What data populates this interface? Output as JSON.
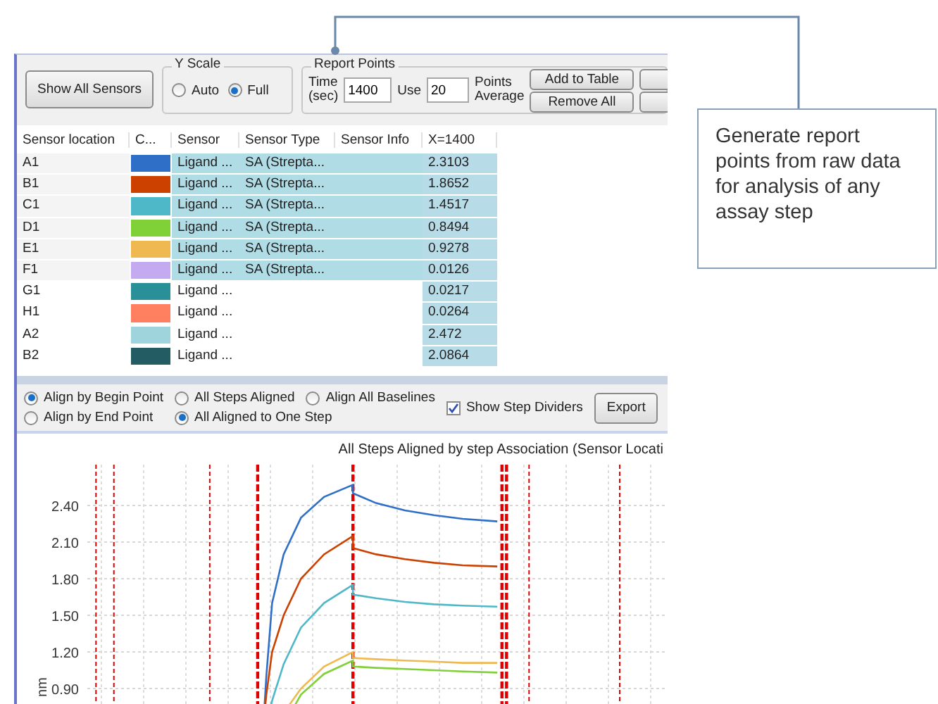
{
  "toolbar": {
    "show_all_button": "Show All Sensors",
    "y_scale": {
      "title": "Y Scale",
      "options": [
        {
          "label": "Auto",
          "selected": false
        },
        {
          "label": "Full",
          "selected": true
        }
      ]
    },
    "report_points": {
      "title": "Report Points",
      "time_label": "Time (sec)",
      "time_value": "1400",
      "use_label": "Use",
      "use_value": "20",
      "points_label": "Points Average",
      "buttons": [
        "Add to Table",
        "Remove All"
      ]
    }
  },
  "table": {
    "columns": [
      "Sensor location",
      "C...",
      "Sensor",
      "Sensor Type",
      "Sensor Info",
      "X=1400"
    ],
    "rows": [
      {
        "location": "A1",
        "color": "#2f6fc8",
        "sensor": "Ligand ...",
        "type": "SA (Strepta...",
        "value": "2.3103",
        "selected": true
      },
      {
        "location": "B1",
        "color": "#cc4000",
        "sensor": "Ligand ...",
        "type": "SA (Strepta...",
        "value": "1.8652",
        "selected": true
      },
      {
        "location": "C1",
        "color": "#4fb8c8",
        "sensor": "Ligand ...",
        "type": "SA (Strepta...",
        "value": "1.4517",
        "selected": true
      },
      {
        "location": "D1",
        "color": "#80d038",
        "sensor": "Ligand ...",
        "type": "SA (Strepta...",
        "value": "0.8494",
        "selected": true
      },
      {
        "location": "E1",
        "color": "#f0b850",
        "sensor": "Ligand ...",
        "type": "SA (Strepta...",
        "value": "0.9278",
        "selected": true
      },
      {
        "location": "F1",
        "color": "#c4aaf0",
        "sensor": "Ligand ...",
        "type": "SA (Strepta...",
        "value": "0.0126",
        "selected": true
      },
      {
        "location": "G1",
        "color": "#2a9098",
        "sensor": "Ligand ...",
        "value": "0.0217",
        "selected": false
      },
      {
        "location": "H1",
        "color": "#ff8060",
        "sensor": "Ligand ...",
        "value": "0.0264",
        "selected": false
      },
      {
        "location": "A2",
        "color": "#a0d4dc",
        "sensor": "Ligand ...",
        "value": "2.472",
        "selected": false
      },
      {
        "location": "B2",
        "color": "#245c64",
        "sensor": "Ligand ...",
        "value": "2.0864",
        "selected": false
      }
    ]
  },
  "options": {
    "align": [
      {
        "label": "Align by Begin Point",
        "selected": true
      },
      {
        "label": "Align by End Point",
        "selected": false
      }
    ],
    "steps": [
      {
        "label": "All Steps Aligned",
        "selected": false
      },
      {
        "label": "All Aligned to One Step",
        "selected": true
      }
    ],
    "baselines": {
      "label": "Align All Baselines",
      "selected": false
    },
    "show_step_dividers": {
      "label": "Show Step Dividers",
      "checked": true
    },
    "export_button": "Export"
  },
  "graph": {
    "title": "All Steps Aligned by step Association (Sensor Locati",
    "y_axis_title": "nm",
    "y_ticks": [
      "2.40",
      "2.10",
      "1.80",
      "1.50",
      "1.20",
      "0.90"
    ]
  },
  "callout": {
    "text": "Generate report points from raw data for analysis of any assay step"
  }
}
